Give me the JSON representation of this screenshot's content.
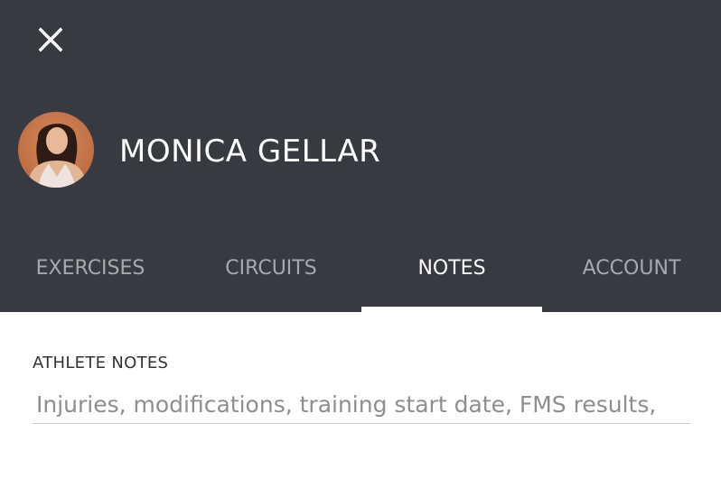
{
  "header": {
    "background_color": "#383a41",
    "close_icon": "close-icon",
    "athlete_name": "MONICA GELLAR"
  },
  "tabs": [
    {
      "label": "EXERCISES",
      "active": false
    },
    {
      "label": "CIRCUITS",
      "active": false
    },
    {
      "label": "NOTES",
      "active": true
    },
    {
      "label": "ACCOUNT",
      "active": false
    }
  ],
  "notes": {
    "label": "ATHLETE NOTES",
    "value": "",
    "placeholder": "Injuries, modifications, training start date, FMS results,"
  }
}
